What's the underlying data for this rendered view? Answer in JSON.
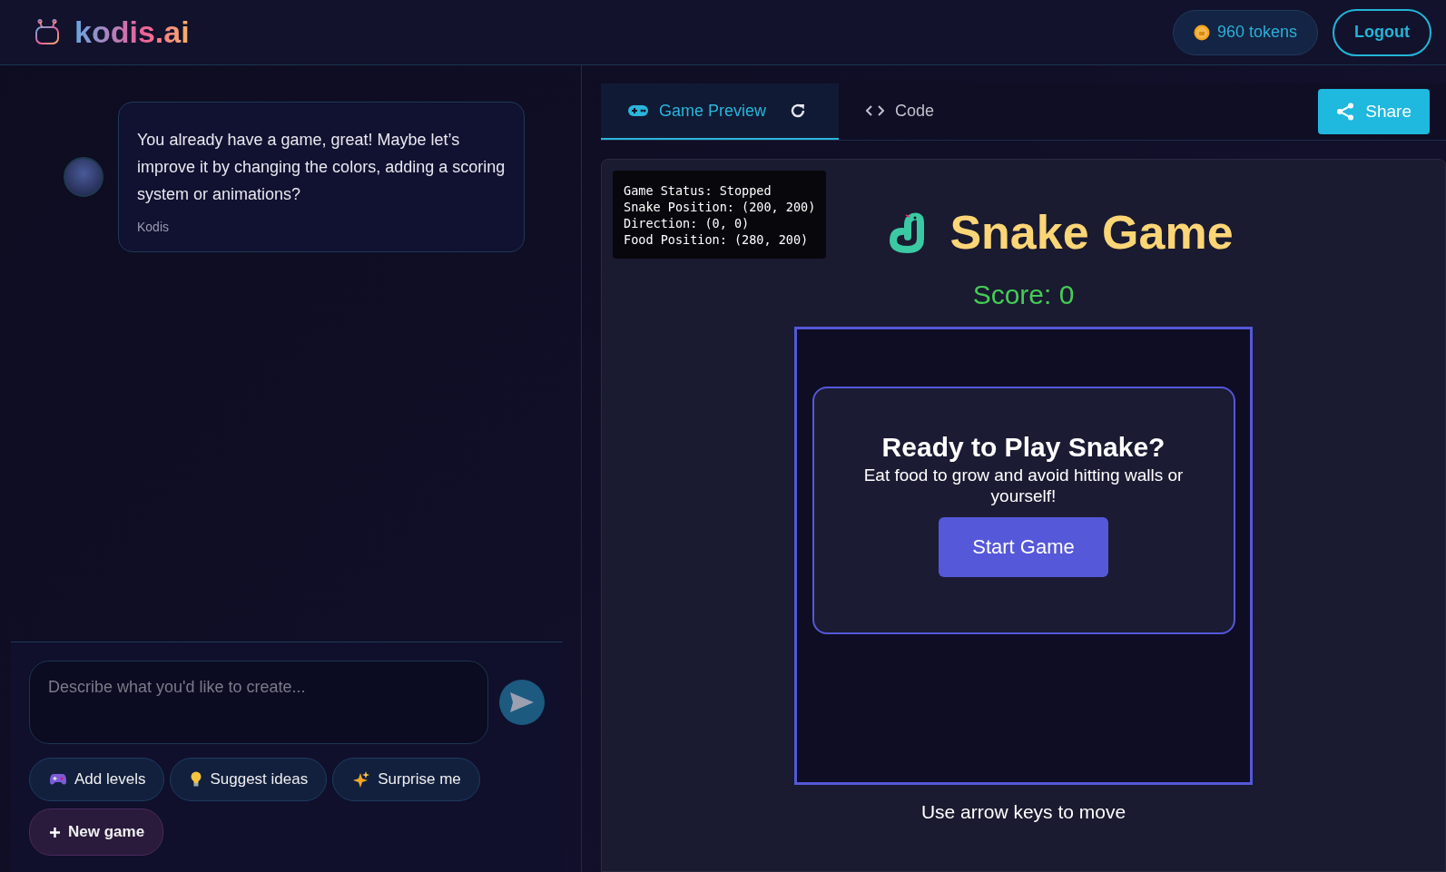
{
  "header": {
    "logo": "kodis.ai",
    "tokens": "960 tokens",
    "logout": "Logout"
  },
  "chat": {
    "messages": [
      {
        "text": "You already have a game, great! Maybe let’s improve it by changing the colors, adding a scoring system or animations?",
        "author": "Kodis"
      }
    ],
    "input": {
      "placeholder": "Describe what you'd like to create..."
    },
    "quick_actions": [
      {
        "label": "Add levels",
        "kind": "gamepad"
      },
      {
        "label": "Suggest ideas",
        "kind": "bulb"
      },
      {
        "label": "Surprise me",
        "kind": "sparkles"
      },
      {
        "label": "New game",
        "kind": "plus"
      }
    ]
  },
  "preview": {
    "tabs": [
      {
        "label": "Game Preview",
        "kind": "game",
        "selected": true
      },
      {
        "label": "Code",
        "kind": "code",
        "selected": false
      }
    ],
    "share": "Share",
    "debug": [
      "Game Status: Stopped",
      "Snake Position: (200, 200)",
      "Direction: (0, 0)",
      "Food Position: (280, 200)"
    ],
    "title": "Snake Game",
    "score": "Score: 0",
    "overlay": {
      "title": "Ready to Play Snake?",
      "text": "Eat food to grow and avoid hitting walls or yourself!",
      "button": "Start Game"
    },
    "hint": "Use arrow keys to move"
  }
}
